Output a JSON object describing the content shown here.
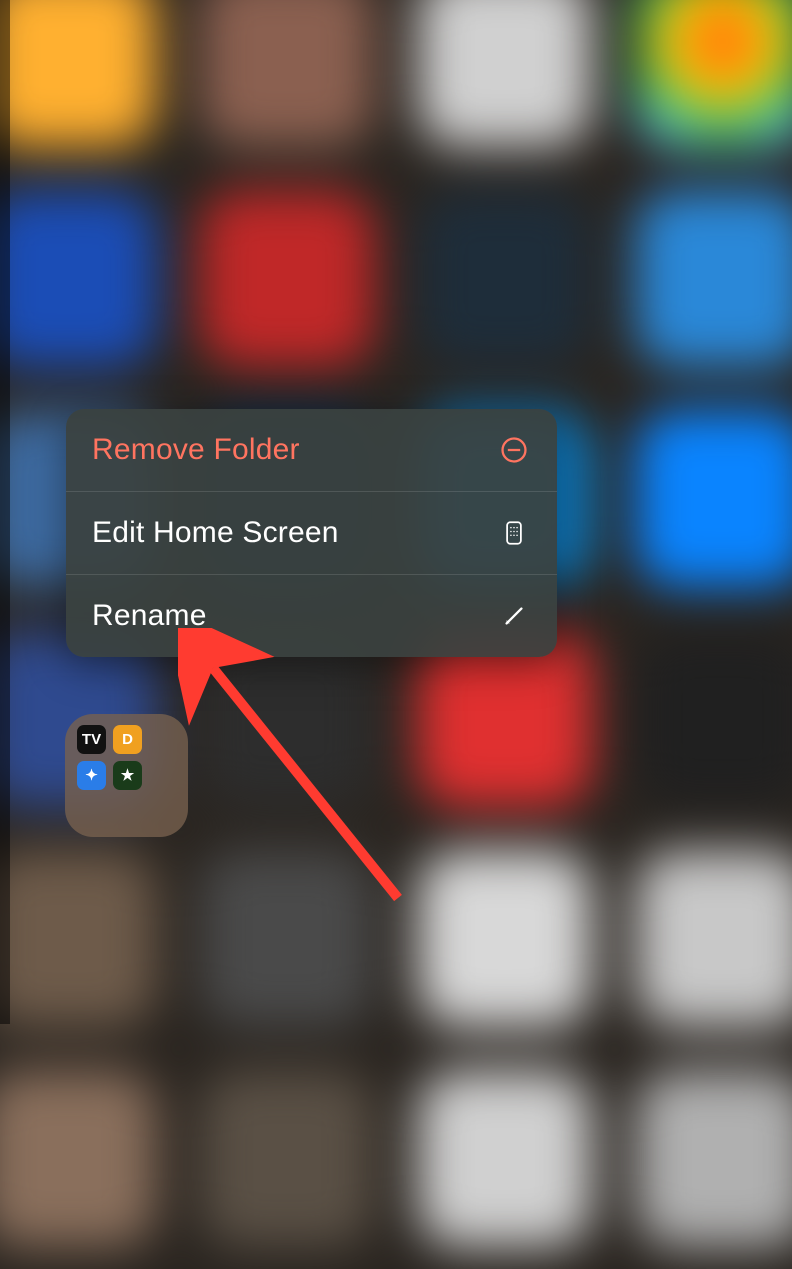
{
  "context_menu": {
    "items": [
      {
        "label": "Remove Folder",
        "icon": "minus-circle",
        "style": "destructive"
      },
      {
        "label": "Edit Home Screen",
        "icon": "homescreen",
        "style": "normal"
      },
      {
        "label": "Rename",
        "icon": "pencil",
        "style": "normal"
      }
    ]
  },
  "folder": {
    "apps": [
      {
        "glyph": "TV",
        "class": "ma1"
      },
      {
        "glyph": "D",
        "class": "ma2"
      },
      {
        "glyph": "✦",
        "class": "ma3"
      },
      {
        "glyph": "★",
        "class": "ma4"
      }
    ]
  },
  "annotation": {
    "arrow_target": "rename-menu-item",
    "arrow_color": "#ff3b30"
  }
}
